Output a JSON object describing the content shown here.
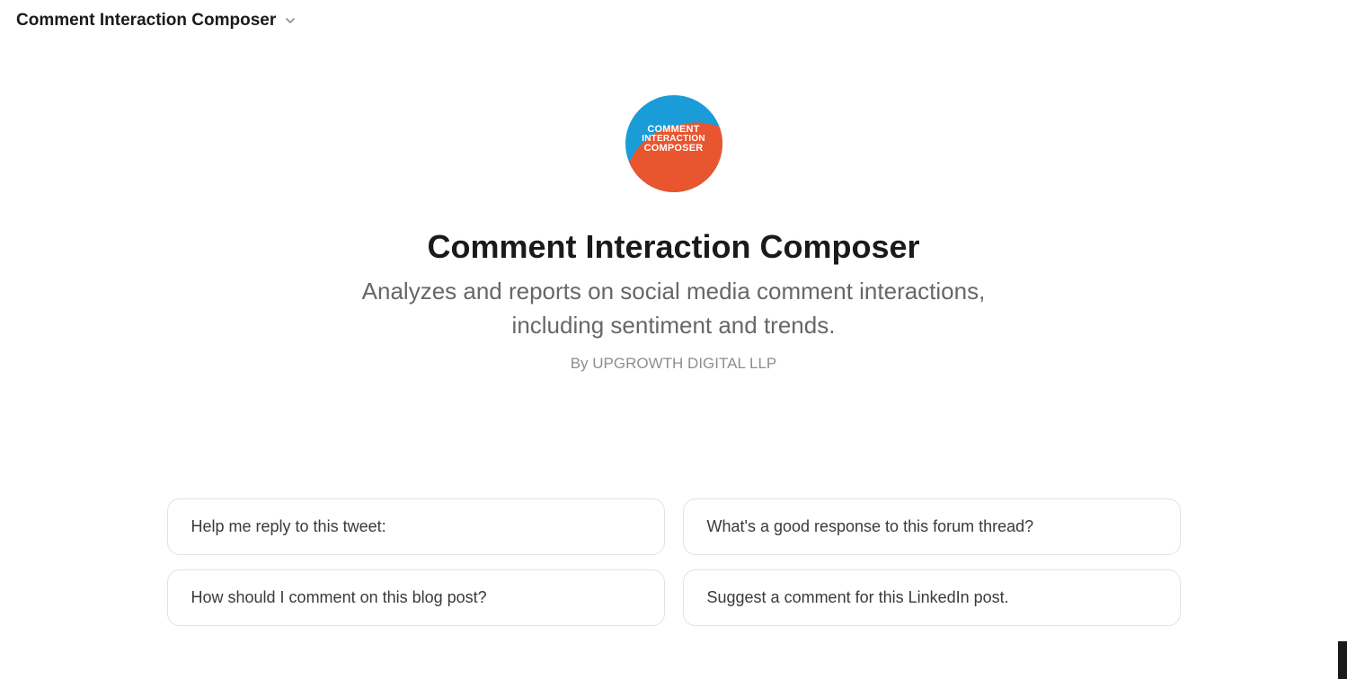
{
  "header": {
    "title": "Comment Interaction Composer"
  },
  "logo": {
    "line1": "COMMENT",
    "line2": "INTERACTION",
    "line3": "COMPOSER"
  },
  "main": {
    "title": "Comment Interaction Composer",
    "subtitle": "Analyzes and reports on social media comment interactions, including sentiment and trends.",
    "byline": "By UPGROWTH DIGITAL LLP"
  },
  "prompts": [
    "Help me reply to this tweet:",
    "What's a good response to this forum thread?",
    "How should I comment on this blog post?",
    "Suggest a comment for this LinkedIn post."
  ]
}
